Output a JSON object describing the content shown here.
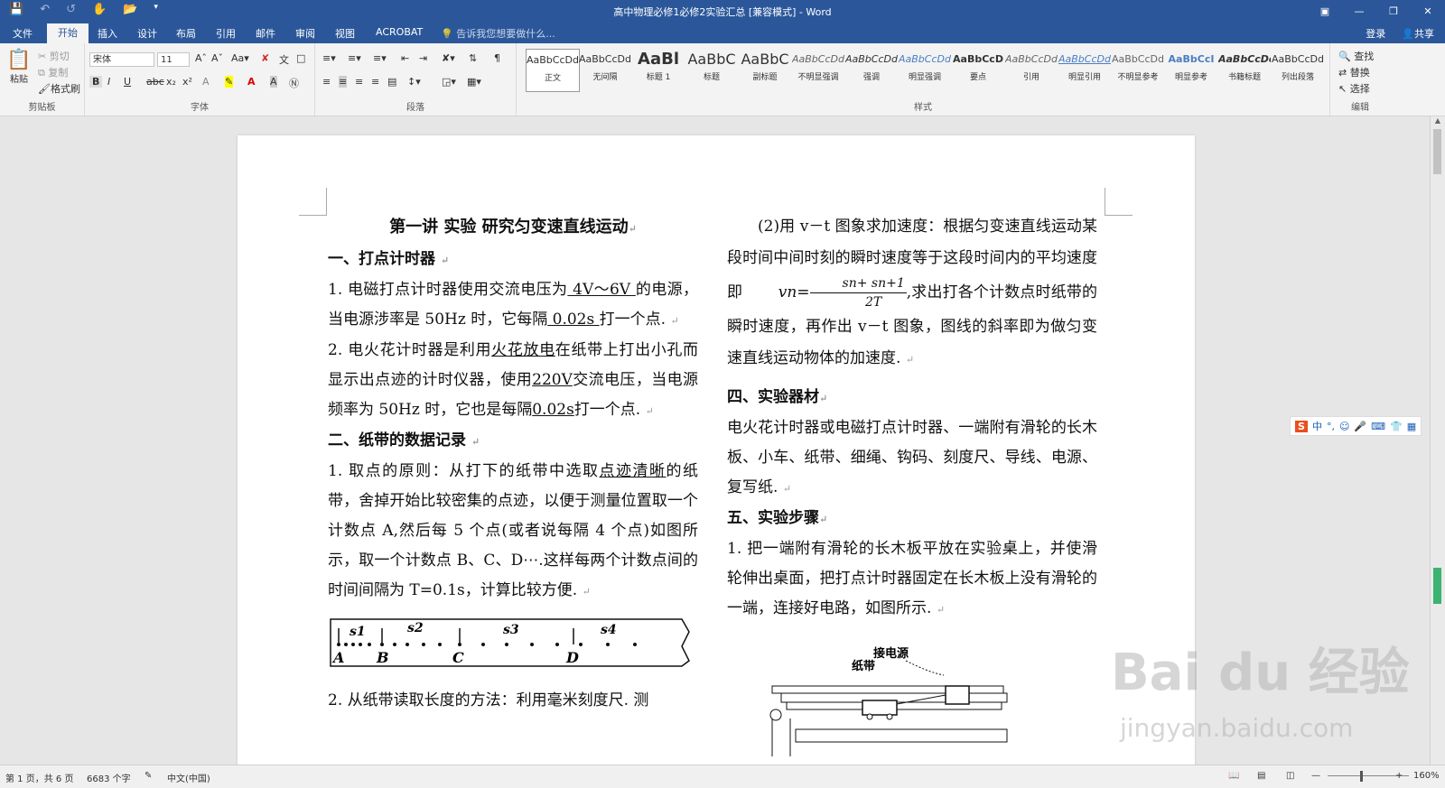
{
  "window": {
    "title": "高中物理必修1必修2实验汇总 [兼容模式] - Word",
    "login": "登录",
    "share": "共享"
  },
  "tabs": [
    "文件",
    "开始",
    "插入",
    "设计",
    "布局",
    "引用",
    "邮件",
    "审阅",
    "视图",
    "ACROBAT"
  ],
  "tell_me": "告诉我您想要做什么...",
  "clipboard": {
    "paste": "粘贴",
    "cut": "剪切",
    "copy": "复制",
    "format_painter": "格式刷",
    "label": "剪贴板"
  },
  "font": {
    "name": "宋体",
    "size": "11",
    "label": "字体"
  },
  "paragraph": {
    "label": "段落"
  },
  "styles": {
    "label": "样式",
    "items": [
      {
        "sample": "AaBbCcDd",
        "name": "正文"
      },
      {
        "sample": "AaBbCcDd",
        "name": "无间隔"
      },
      {
        "sample": "AaBl",
        "name": "标题 1"
      },
      {
        "sample": "AaBbC",
        "name": "标题"
      },
      {
        "sample": "AaBbC",
        "name": "副标题"
      },
      {
        "sample": "AaBbCcDd",
        "name": "不明显强调"
      },
      {
        "sample": "AaBbCcDd",
        "name": "强调"
      },
      {
        "sample": "AaBbCcDd",
        "name": "明显强调"
      },
      {
        "sample": "AaBbCcD",
        "name": "要点"
      },
      {
        "sample": "AaBbCcDd",
        "name": "引用"
      },
      {
        "sample": "AaBbCcDd",
        "name": "明显引用"
      },
      {
        "sample": "AaBbCcDd",
        "name": "不明显参考"
      },
      {
        "sample": "AaBbCcI",
        "name": "明显参考"
      },
      {
        "sample": "AaBbCcDd",
        "name": "书籍标题"
      },
      {
        "sample": "AaBbCcDd",
        "name": "列出段落"
      }
    ]
  },
  "editing": {
    "find": "查找",
    "replace": "替换",
    "select": "选择",
    "label": "编辑"
  },
  "doc": {
    "title": "第一讲 实验 研究匀变速直线运动",
    "left": {
      "h1": "一、打点计时器",
      "p1_a": "1. 电磁打点计时器使用交流电压为",
      "p1_u1": " 4V～6V ",
      "p1_b": "的电源，当电源涉率是 50Hz 时，它每隔",
      "p1_u2": " 0.02s  ",
      "p1_c": "打一个点.",
      "p2_a": "2. 电火花计时器是利用",
      "p2_u1": "火花放电",
      "p2_b": "在纸带上打出小孔而显示出点迹的计时仪器，使用",
      "p2_u2": "220V",
      "p2_c": "交流电压，当电源频率为 50Hz 时，它也是每隔",
      "p2_u3": "0.02s",
      "p2_d": "打一个点.",
      "h2": "二、纸带的数据记录",
      "p3_a": "1. 取点的原则：从打下的纸带中选取",
      "p3_u1": "点迹清晰",
      "p3_b": "的纸带，舍掉开始比较密集的点迹，以便于测量位置取一个计数点 A,然后每 5 个点(或者说每隔 4 个点)如图所示，取一个计数点 B、C、D⋯.这样每两个计数点间的时间间隔为 T=0.1s，计算比较方便.",
      "tape_labels": [
        "A",
        "B",
        "C",
        "D"
      ],
      "tape_s": [
        "s1",
        "s2",
        "s3",
        "s4"
      ],
      "p4": "2. 从纸带读取长度的方法：利用毫米刻度尺. 测"
    },
    "right": {
      "p1_a": "(2)用 v－t 图象求加速度：根据匀变速直线运动某段时间中间时刻的瞬时速度等于这段时间内的平均速度即 ",
      "formula_lhs": "vn=",
      "formula_num": "sn+ sn+1",
      "formula_den": "2T",
      "p1_b": ",求出打各个计数点时纸带的瞬时速度，再作出 v－t 图象，图线的斜率即为做匀变速直线运动物体的加速度.",
      "h4": "四、实验器材",
      "p4": "电火花计时器或电磁打点计时器、一端附有滑轮的长木板、小车、纸带、细绳、钩码、刻度尺、导线、电源、复写纸.",
      "h5": "五、实验步骤",
      "p5": "1. 把一端附有滑轮的长木板平放在实验桌上，并使滑轮伸出桌面，把打点计时器固定在长木板上没有滑轮的一端，连接好电路，如图所示.",
      "fig_power": "接电源",
      "fig_tape": "纸带"
    }
  },
  "ime": {
    "lang": "中"
  },
  "watermark": {
    "brand": "Bai du 经验",
    "url": "jingyan.baidu.com"
  },
  "status": {
    "page": "第 1 页，共 6 页",
    "words": "6683 个字",
    "lang": "中文(中国)",
    "zoom": "160%"
  }
}
